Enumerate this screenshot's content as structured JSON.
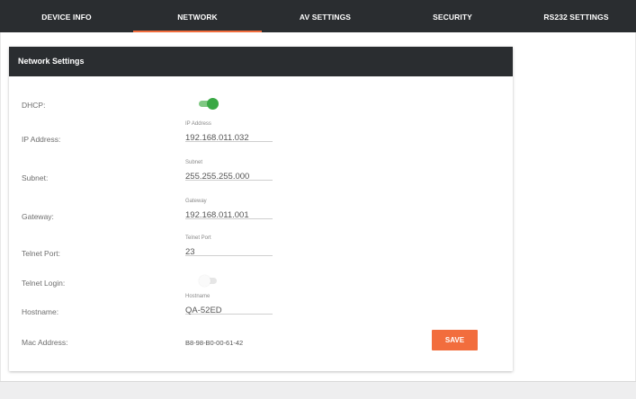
{
  "tabs": [
    {
      "label": "DEVICE INFO",
      "active": false
    },
    {
      "label": "NETWORK",
      "active": true
    },
    {
      "label": "AV SETTINGS",
      "active": false
    },
    {
      "label": "SECURITY",
      "active": false
    },
    {
      "label": "RS232 SETTINGS",
      "active": false
    }
  ],
  "card": {
    "title": "Network Settings"
  },
  "dhcp": {
    "label": "DHCP:",
    "enabled": true
  },
  "ip": {
    "label": "IP Address:",
    "caption": "IP Address",
    "value": "192.168.011.032"
  },
  "subnet": {
    "label": "Subnet:",
    "caption": "Subnet",
    "value": "255.255.255.000"
  },
  "gateway": {
    "label": "Gateway:",
    "caption": "Gateway",
    "value": "192.168.011.001"
  },
  "telnet_port": {
    "label": "Telnet Port:",
    "caption": "Telnet Port",
    "value": "23"
  },
  "telnet_login": {
    "label": "Telnet Login:",
    "enabled": false
  },
  "hostname": {
    "label": "Hostname:",
    "caption": "Hostname",
    "value": "QA-52ED"
  },
  "mac": {
    "label": "Mac Address:",
    "value": "B8-98-B0-00-61-42"
  },
  "save_label": "SAVE",
  "colors": {
    "accent": "#f26d3d",
    "header": "#2a2d30",
    "toggle_on": "#3aa845"
  }
}
